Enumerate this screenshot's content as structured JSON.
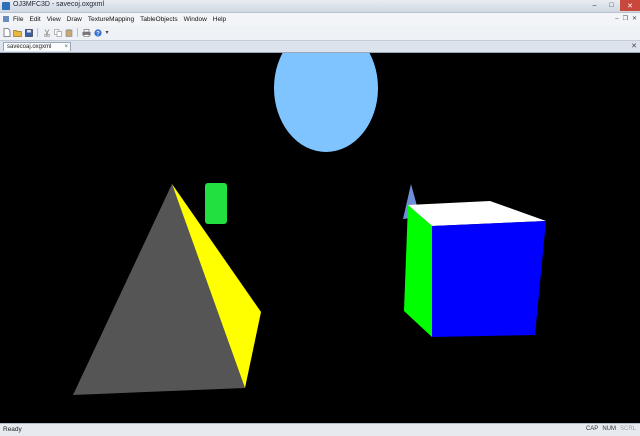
{
  "window": {
    "title": "OJ3MFC3D - savecoj.oxgxml",
    "minimize_glyph": "–",
    "maximize_glyph": "□",
    "close_glyph": "✕"
  },
  "menubar": {
    "items": [
      "File",
      "Edit",
      "View",
      "Draw",
      "TextureMapping",
      "TableObjects",
      "Window",
      "Help"
    ],
    "mdi_minimize": "–",
    "mdi_restore": "❐",
    "mdi_close": "✕"
  },
  "toolbar": {
    "icons": [
      "new-icon",
      "open-icon",
      "save-icon",
      "cut-icon",
      "copy-icon",
      "paste-icon",
      "print-icon",
      "help-icon"
    ],
    "overflow_glyph": "▾"
  },
  "document_tab": {
    "label": "savecoaj.oxgxml",
    "close_glyph": "×",
    "close_all_glyph": "✕"
  },
  "scene": {
    "background": "#000000",
    "objects": [
      {
        "name": "sphere",
        "color": "#80c4ff"
      },
      {
        "name": "small-green-box",
        "color": "#22e040"
      },
      {
        "name": "pyramid",
        "colors": [
          "#555555",
          "#ffff00"
        ]
      },
      {
        "name": "cube",
        "colors": [
          "#ffffff",
          "#00ff00",
          "#0000ff"
        ]
      },
      {
        "name": "small-cone",
        "color": "#6e8fd8"
      }
    ]
  },
  "statusbar": {
    "text": "Ready",
    "indicators": [
      "CAP",
      "NUM",
      "SCRL"
    ]
  }
}
